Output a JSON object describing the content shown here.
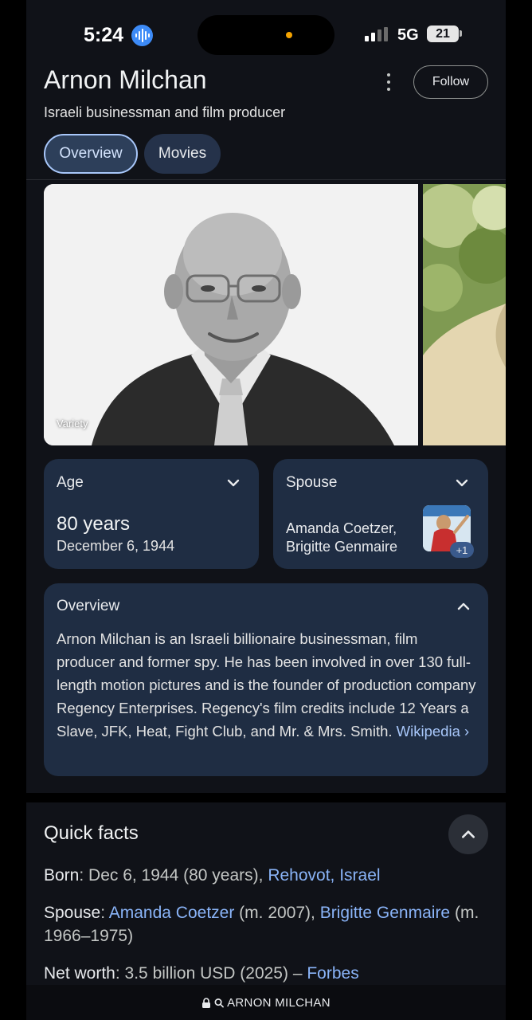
{
  "status_bar": {
    "time": "5:24",
    "network": "5G",
    "battery": "21"
  },
  "header": {
    "title": "Arnon Milchan",
    "subtitle": "Israeli businessman and film producer",
    "follow_label": "Follow"
  },
  "tabs": [
    {
      "label": "Overview",
      "selected": true
    },
    {
      "label": "Movies",
      "selected": false
    }
  ],
  "images": {
    "primary_source": "Variety"
  },
  "age_card": {
    "label": "Age",
    "value": "80 years",
    "date": "December 6, 1944"
  },
  "spouse_card": {
    "label": "Spouse",
    "names": "Amanda Coetzer, Brigitte Genmaire",
    "more_badge": "+1"
  },
  "overview": {
    "heading": "Overview",
    "text": "Arnon Milchan is an Israeli billionaire businessman, film producer and former spy. He has been involved in over 130 full-length motion pictures and is the founder of production company Regency Enterprises. Regency's film credits include 12 Years a Slave, JFK, Heat, Fight Club, and Mr. & Mrs. Smith. ",
    "link_label": "Wikipedia",
    "link_chevron": "›"
  },
  "quick_facts": {
    "title": "Quick facts",
    "born": {
      "label": "Born",
      "text": ": Dec 6, 1944 (80 years), ",
      "link": "Rehovot, Israel"
    },
    "spouse": {
      "label": "Spouse",
      "sep1": ": ",
      "link1": "Amanda Coetzer",
      "mid": " (m. 2007), ",
      "link2": "Brigitte Genmaire",
      "tail": " (m. 1966–1975)"
    },
    "net_worth": {
      "label": "Net worth",
      "text": ": 3.5 billion USD (2025) – ",
      "link": "Forbes"
    }
  },
  "address_bar": {
    "query": "ARNON MILCHAN"
  },
  "colors": {
    "page_bg": "#101218",
    "card_bg": "#1f2d43",
    "link": "#8ab4f8",
    "selected_tab_border": "#a8c7fa"
  }
}
